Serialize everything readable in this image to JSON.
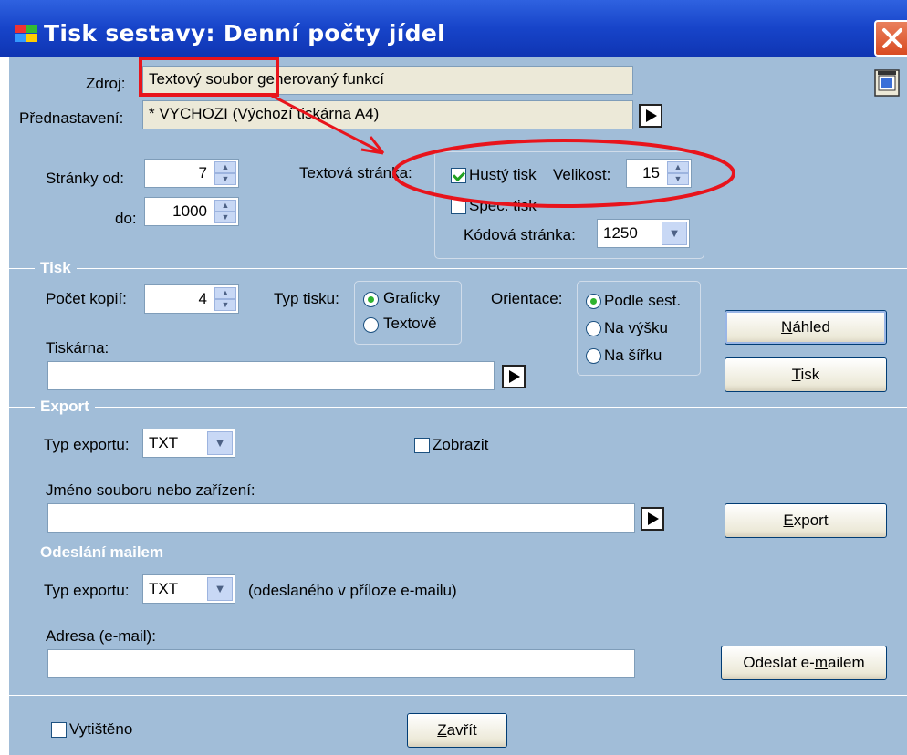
{
  "window": {
    "title": "Tisk sestavy:  Denní počty jídel"
  },
  "source": {
    "label": "Zdroj:",
    "value": "Textový soubor generovaný funkcí"
  },
  "preset": {
    "label": "Přednastavení:",
    "value": "* VYCHOZI (Výchozí tiskárna A4)"
  },
  "pages": {
    "from_label": "Stránky  od:",
    "from_value": "7",
    "to_label": "do:",
    "to_value": "1000"
  },
  "text_page": {
    "label": "Textová stránka:",
    "dense_print": {
      "label": "Hustý tisk",
      "checked": true
    },
    "size_label": "Velikost:",
    "size_value": "15",
    "spec_print": {
      "label": "Spec. tisk",
      "checked": false
    },
    "codepage_label": "Kódová stránka:",
    "codepage_value": "1250"
  },
  "print_section": {
    "title": "Tisk",
    "copies_label": "Počet kopií:",
    "copies_value": "4",
    "type_label": "Typ tisku:",
    "type_options": [
      {
        "label": "Graficky",
        "selected": true
      },
      {
        "label": "Textově",
        "selected": false
      }
    ],
    "orientation_label": "Orientace:",
    "orientation_options": [
      {
        "label": "Podle sest.",
        "selected": true
      },
      {
        "label": "Na výšku",
        "selected": false
      },
      {
        "label": "Na šířku",
        "selected": false
      }
    ],
    "printer_label": "Tiskárna:",
    "printer_value": "",
    "preview_button": {
      "label_pre": "",
      "label_key": "N",
      "label_post": "áhled"
    },
    "print_button": {
      "label_pre": "",
      "label_key": "T",
      "label_post": "isk"
    }
  },
  "export_section": {
    "title": "Export",
    "type_label": "Typ exportu:",
    "type_value": "TXT",
    "show": {
      "label": "Zobrazit",
      "checked": false
    },
    "filename_label": "Jméno souboru nebo zařízení:",
    "filename_value": "",
    "export_button": {
      "label_pre": "",
      "label_key": "E",
      "label_post": "xport"
    }
  },
  "mail_section": {
    "title": "Odeslání mailem",
    "type_label": "Typ exportu:",
    "type_value": "TXT",
    "type_note": "(odeslaného v příloze e-mailu)",
    "address_label": "Adresa (e-mail):",
    "address_value": "",
    "send_button": {
      "label_pre": "Odeslat e-",
      "label_key": "m",
      "label_post": "ailem"
    }
  },
  "footer": {
    "printed": {
      "label": "Vytištěno",
      "checked": false
    },
    "close_button": {
      "label_pre": "",
      "label_key": "Z",
      "label_post": "avřít"
    }
  },
  "colors": {
    "titlebar": "#1744c9",
    "client": "#a1bdd8",
    "annotation": "#e8141c"
  }
}
